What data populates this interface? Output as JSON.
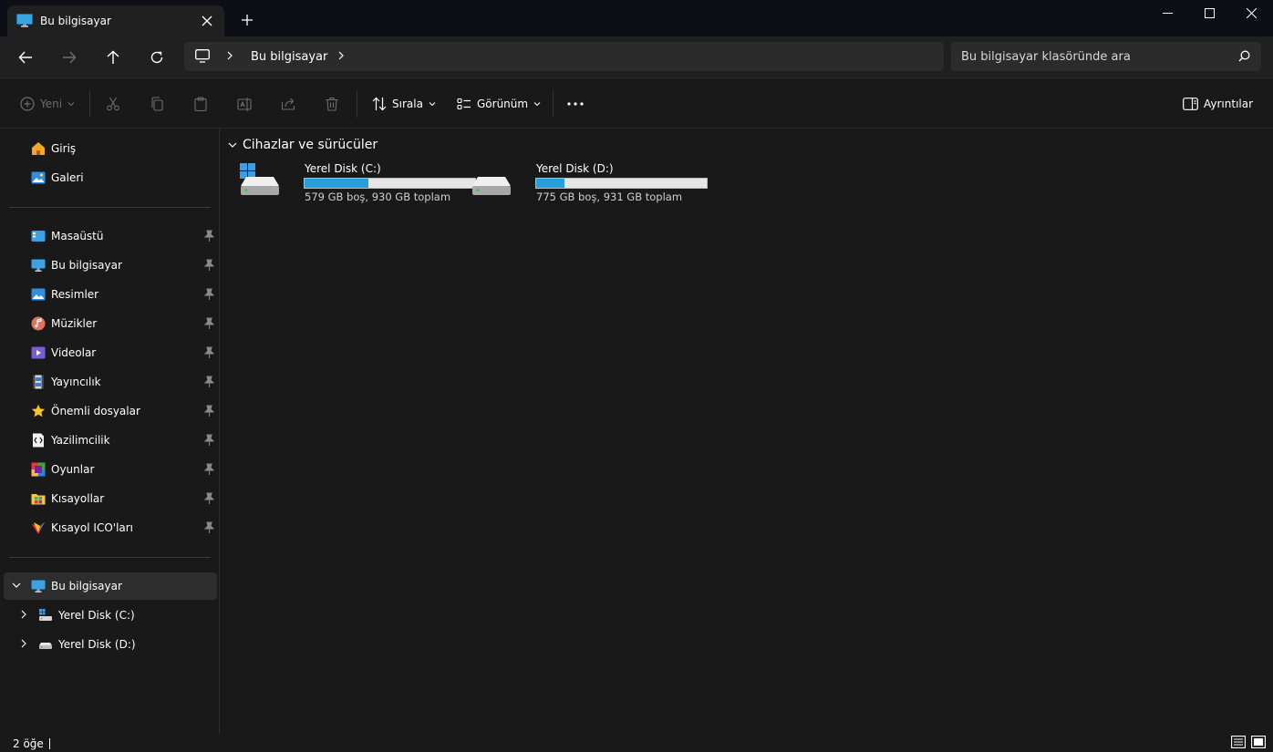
{
  "window": {
    "tab_title": "Bu bilgisayar",
    "icons": [
      "monitor-icon",
      "close-icon",
      "plus-icon",
      "minimize-icon",
      "maximize-icon",
      "close-window-icon"
    ]
  },
  "navigation": {
    "address_segment": "Bu bilgisayar",
    "search_placeholder": "Bu bilgisayar klasöründe ara"
  },
  "commands": {
    "new_label": "Yeni",
    "sort_label": "Sırala",
    "view_label": "Görünüm",
    "details_label": "Ayrıntılar"
  },
  "sidebar": {
    "top_items": [
      {
        "label": "Giriş",
        "icon": "home-icon"
      },
      {
        "label": "Galeri",
        "icon": "gallery-icon"
      }
    ],
    "pinned_items": [
      {
        "label": "Masaüstü",
        "icon": "desktop-icon"
      },
      {
        "label": "Bu bilgisayar",
        "icon": "monitor-icon"
      },
      {
        "label": "Resimler",
        "icon": "pictures-icon"
      },
      {
        "label": "Müzikler",
        "icon": "music-icon"
      },
      {
        "label": "Videolar",
        "icon": "videos-icon"
      },
      {
        "label": "Yayıncılık",
        "icon": "film-icon"
      },
      {
        "label": "Önemli dosyalar",
        "icon": "star-icon"
      },
      {
        "label": "Yazilimcilik",
        "icon": "code-file-icon"
      },
      {
        "label": "Oyunlar",
        "icon": "games-icon"
      },
      {
        "label": "Kısayollar",
        "icon": "shortcuts-folder-icon"
      },
      {
        "label": "Kısayol ICO'ları",
        "icon": "ico-icon"
      }
    ],
    "tree": [
      {
        "label": "Bu bilgisayar",
        "icon": "monitor-icon",
        "expanded": true
      },
      {
        "label": "Yerel Disk (C:)",
        "icon": "windows-drive-icon"
      },
      {
        "label": "Yerel Disk (D:)",
        "icon": "drive-icon"
      }
    ]
  },
  "content": {
    "group_title": "Cihazlar ve sürücüler",
    "drives": [
      {
        "name": "Yerel Disk (C:)",
        "info": "579 GB boş, 930 GB toplam",
        "used_fraction": 0.377,
        "system": true
      },
      {
        "name": "Yerel Disk (D:)",
        "info": "775 GB boş, 931 GB toplam",
        "used_fraction": 0.168,
        "system": false
      }
    ]
  },
  "status": {
    "item_count": "2 öğe"
  },
  "colors": {
    "accent": "#26a0da",
    "background": "#191919",
    "titlebar": "#0d0f17"
  }
}
